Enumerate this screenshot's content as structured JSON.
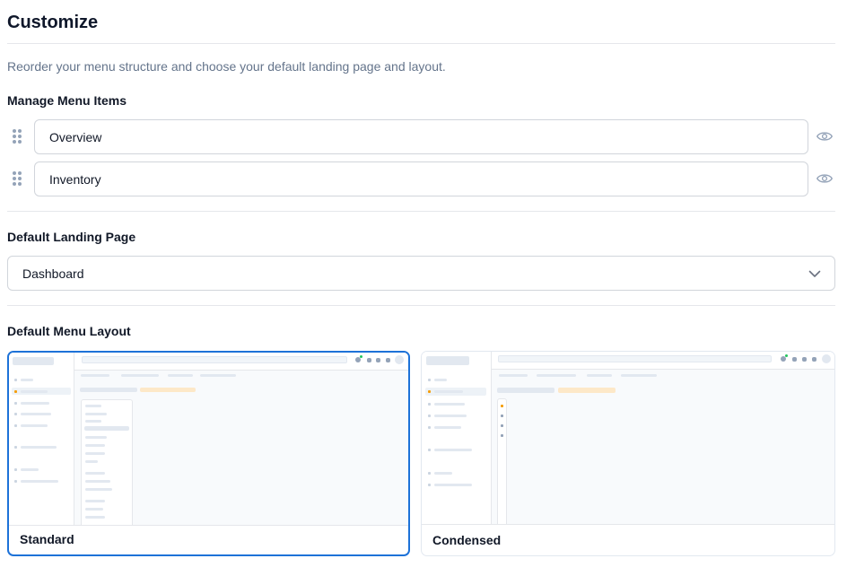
{
  "header": {
    "title": "Customize"
  },
  "description": "Reorder your menu structure and choose your default landing page and layout.",
  "menu_items_section": {
    "title": "Manage Menu Items",
    "items": [
      {
        "label": "Overview",
        "visible": true
      },
      {
        "label": "Inventory",
        "visible": true
      }
    ]
  },
  "landing_section": {
    "title": "Default Landing Page",
    "selected": "Dashboard"
  },
  "layout_section": {
    "title": "Default Menu Layout",
    "options": [
      {
        "label": "Standard",
        "selected": true
      },
      {
        "label": "Condensed",
        "selected": false
      }
    ]
  },
  "colors": {
    "accent": "#1d72d8",
    "muted_text": "#64748b",
    "border": "#d1d5db"
  },
  "icons": [
    "drag-handle-icon",
    "eye-icon",
    "chevron-down-icon"
  ]
}
